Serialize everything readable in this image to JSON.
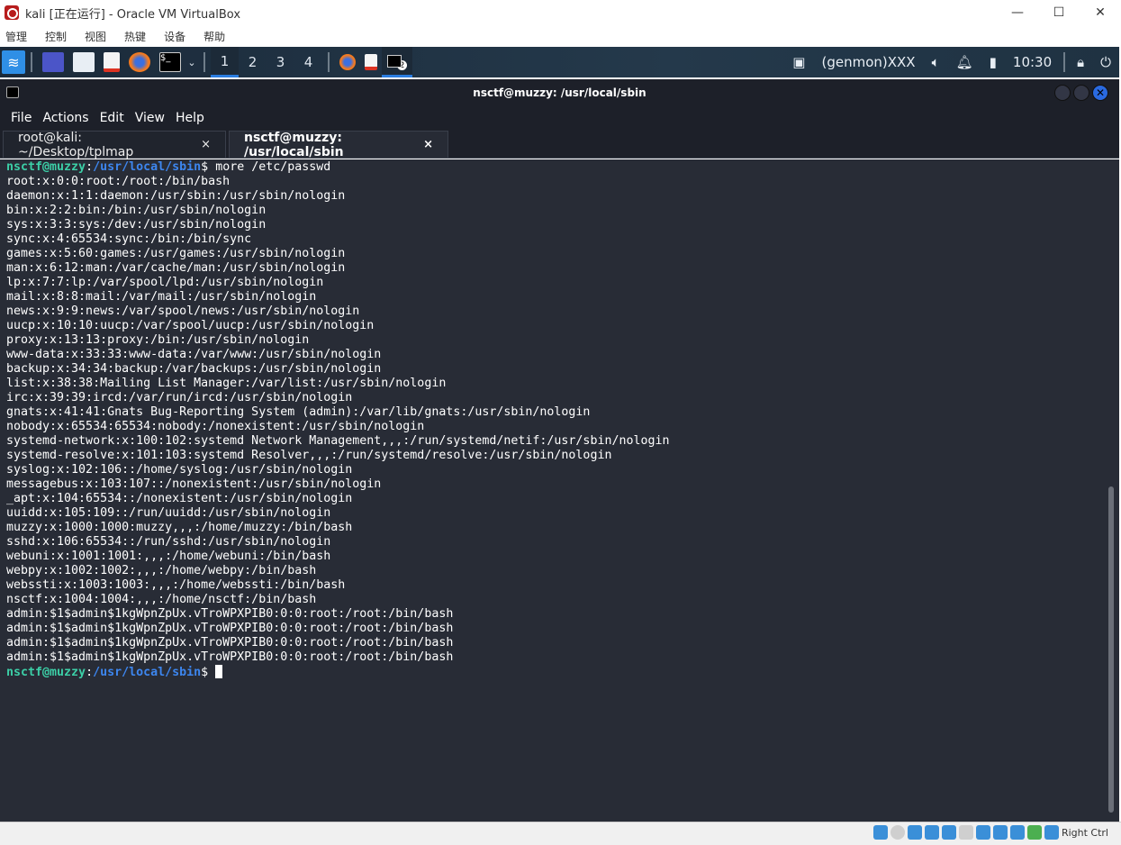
{
  "window": {
    "title": "kali [正在运行] - Oracle VM VirtualBox",
    "minimize": "—",
    "maximize": "☐",
    "close": "✕"
  },
  "vb_menu": [
    "管理",
    "控制",
    "视图",
    "热键",
    "设备",
    "帮助"
  ],
  "panel": {
    "workspaces": [
      "1",
      "2",
      "3",
      "4"
    ],
    "active_workspace": "1",
    "genmon": "(genmon)XXX",
    "clock": "10:30",
    "terminal_badge": "2"
  },
  "terminal": {
    "title": "nsctf@muzzy: /usr/local/sbin",
    "menu": [
      "File",
      "Actions",
      "Edit",
      "View",
      "Help"
    ],
    "tabs": [
      {
        "label": "root@kali: ~/Desktop/tplmap",
        "active": false
      },
      {
        "label": "nsctf@muzzy: /usr/local/sbin",
        "active": true
      }
    ],
    "tab_close": "×",
    "prompt_user": "nsctf@muzzy",
    "prompt_path": "/usr/local/sbin",
    "prompt_sep": ":",
    "prompt_symbol": "$",
    "command": " more /etc/passwd",
    "output": [
      "root:x:0:0:root:/root:/bin/bash",
      "daemon:x:1:1:daemon:/usr/sbin:/usr/sbin/nologin",
      "bin:x:2:2:bin:/bin:/usr/sbin/nologin",
      "sys:x:3:3:sys:/dev:/usr/sbin/nologin",
      "sync:x:4:65534:sync:/bin:/bin/sync",
      "games:x:5:60:games:/usr/games:/usr/sbin/nologin",
      "man:x:6:12:man:/var/cache/man:/usr/sbin/nologin",
      "lp:x:7:7:lp:/var/spool/lpd:/usr/sbin/nologin",
      "mail:x:8:8:mail:/var/mail:/usr/sbin/nologin",
      "news:x:9:9:news:/var/spool/news:/usr/sbin/nologin",
      "uucp:x:10:10:uucp:/var/spool/uucp:/usr/sbin/nologin",
      "proxy:x:13:13:proxy:/bin:/usr/sbin/nologin",
      "www-data:x:33:33:www-data:/var/www:/usr/sbin/nologin",
      "backup:x:34:34:backup:/var/backups:/usr/sbin/nologin",
      "list:x:38:38:Mailing List Manager:/var/list:/usr/sbin/nologin",
      "irc:x:39:39:ircd:/var/run/ircd:/usr/sbin/nologin",
      "gnats:x:41:41:Gnats Bug-Reporting System (admin):/var/lib/gnats:/usr/sbin/nologin",
      "nobody:x:65534:65534:nobody:/nonexistent:/usr/sbin/nologin",
      "systemd-network:x:100:102:systemd Network Management,,,:/run/systemd/netif:/usr/sbin/nologin",
      "systemd-resolve:x:101:103:systemd Resolver,,,:/run/systemd/resolve:/usr/sbin/nologin",
      "syslog:x:102:106::/home/syslog:/usr/sbin/nologin",
      "messagebus:x:103:107::/nonexistent:/usr/sbin/nologin",
      "_apt:x:104:65534::/nonexistent:/usr/sbin/nologin",
      "uuidd:x:105:109::/run/uuidd:/usr/sbin/nologin",
      "muzzy:x:1000:1000:muzzy,,,:/home/muzzy:/bin/bash",
      "sshd:x:106:65534::/run/sshd:/usr/sbin/nologin",
      "webuni:x:1001:1001:,,,:/home/webuni:/bin/bash",
      "webpy:x:1002:1002:,,,:/home/webpy:/bin/bash",
      "webssti:x:1003:1003:,,,:/home/webssti:/bin/bash",
      "nsctf:x:1004:1004:,,,:/home/nsctf:/bin/bash",
      "admin:$1$admin$1kgWpnZpUx.vTroWPXPIB0:0:0:root:/root:/bin/bash",
      "admin:$1$admin$1kgWpnZpUx.vTroWPXPIB0:0:0:root:/root:/bin/bash",
      "admin:$1$admin$1kgWpnZpUx.vTroWPXPIB0:0:0:root:/root:/bin/bash",
      "admin:$1$admin$1kgWpnZpUx.vTroWPXPIB0:0:0:root:/root:/bin/bash"
    ]
  },
  "statusbar": {
    "host_key": "Right Ctrl"
  },
  "colors": {
    "prompt_user": "#3ccfa7",
    "prompt_path": "#3d86ef",
    "terminal_bg": "#282c36",
    "accent": "#2a7de1"
  }
}
